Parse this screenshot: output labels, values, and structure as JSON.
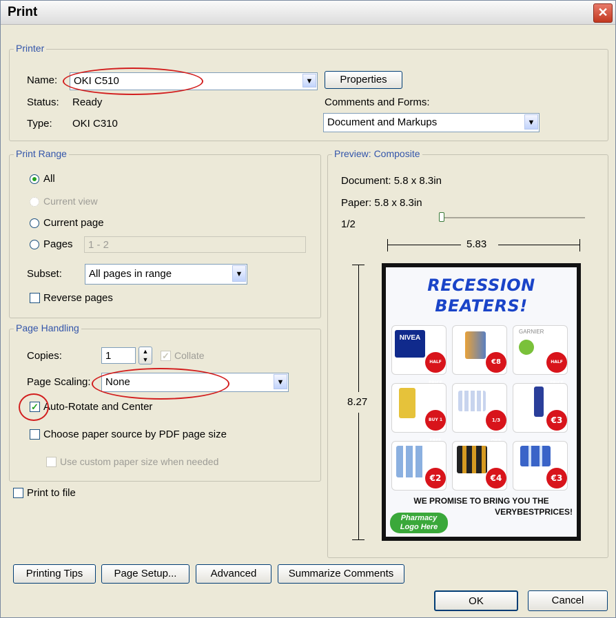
{
  "window": {
    "title": "Print",
    "close_icon": "close-icon"
  },
  "printer": {
    "legend": "Printer",
    "name_label": "Name:",
    "name_value": "OKI C510",
    "properties_label": "Properties",
    "status_label": "Status:",
    "status_value": "Ready",
    "type_label": "Type:",
    "type_value": "OKI C310",
    "comments_label": "Comments and Forms:",
    "comments_value": "Document and Markups"
  },
  "print_range": {
    "legend": "Print Range",
    "all_label": "All",
    "current_view_label": "Current view",
    "current_page_label": "Current page",
    "pages_label": "Pages",
    "pages_value": "1 - 2",
    "subset_label": "Subset:",
    "subset_value": "All pages in range",
    "reverse_label": "Reverse pages"
  },
  "page_handling": {
    "legend": "Page Handling",
    "copies_label": "Copies:",
    "copies_value": "1",
    "collate_label": "Collate",
    "scaling_label": "Page Scaling:",
    "scaling_value": "None",
    "autorotate_label": "Auto-Rotate and Center",
    "autorotate_checked": true,
    "paper_source_label": "Choose paper source by PDF page size",
    "custom_paper_label": "Use custom paper size when needed"
  },
  "print_to_file_label": "Print to file",
  "preview": {
    "legend": "Preview: Composite",
    "document_text": "Document: 5.8 x 8.3in",
    "paper_text": "Paper: 5.8 x 8.3in",
    "page_indicator": "1/2",
    "width_label": "5.83",
    "height_label": "8.27",
    "poster": {
      "headline1": "RECESSION",
      "headline2": "BEATERS!",
      "brand1": "NIVEA",
      "brand2": "GARNIER",
      "badges": [
        "HALF PRICE",
        "€8",
        "HALF PRICE",
        "BUY 1 FREE",
        "1/3 OFF",
        "€3",
        "€2",
        "€4",
        "€3"
      ],
      "promise_line1": "WE PROMISE TO BRING YOU THE",
      "promise_line2": "VERYBESTPRICES!",
      "logo_line1": "Pharmacy",
      "logo_line2": "Logo Here"
    }
  },
  "buttons": {
    "printing_tips": "Printing Tips",
    "page_setup": "Page Setup...",
    "advanced": "Advanced",
    "summarize": "Summarize Comments",
    "ok": "OK",
    "cancel": "Cancel"
  }
}
